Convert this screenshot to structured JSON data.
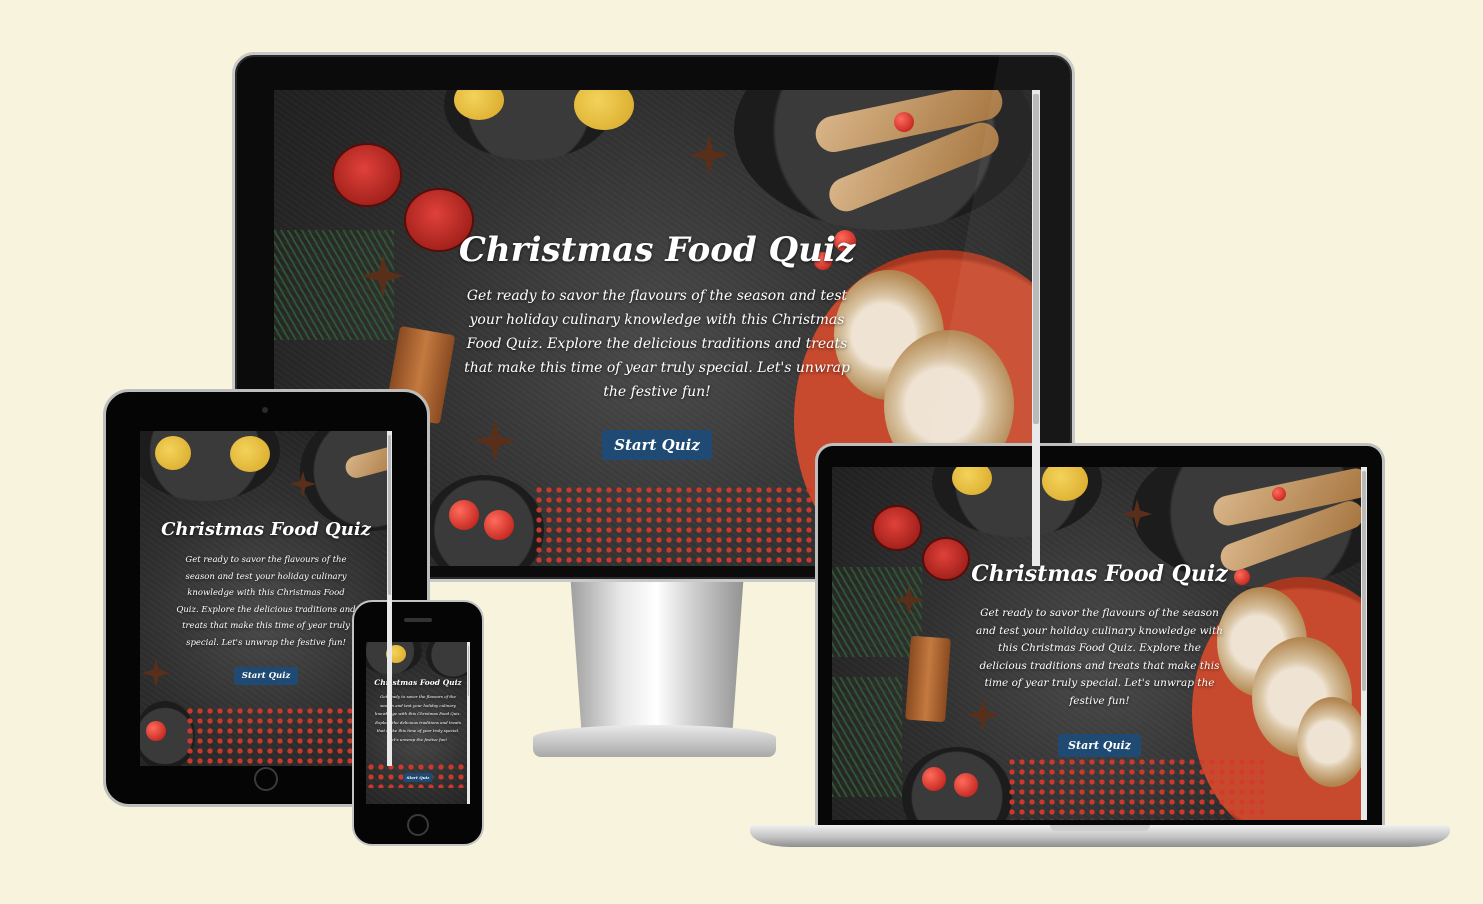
{
  "site": {
    "title": "Christmas Food Quiz",
    "intro": "Get ready to savor the flavours of the season and test your holiday culinary knowledge with this Christmas Food Quiz. Explore the delicious traditions and treats that make this time of year truly special. Let's unwrap the festive fun!",
    "start_button": "Start Quiz"
  },
  "devices": [
    "desktop-monitor",
    "tablet",
    "phone",
    "laptop"
  ],
  "colors": {
    "page_background": "#f7f3dc",
    "button": "#1f4a73",
    "text": "#ffffff"
  }
}
